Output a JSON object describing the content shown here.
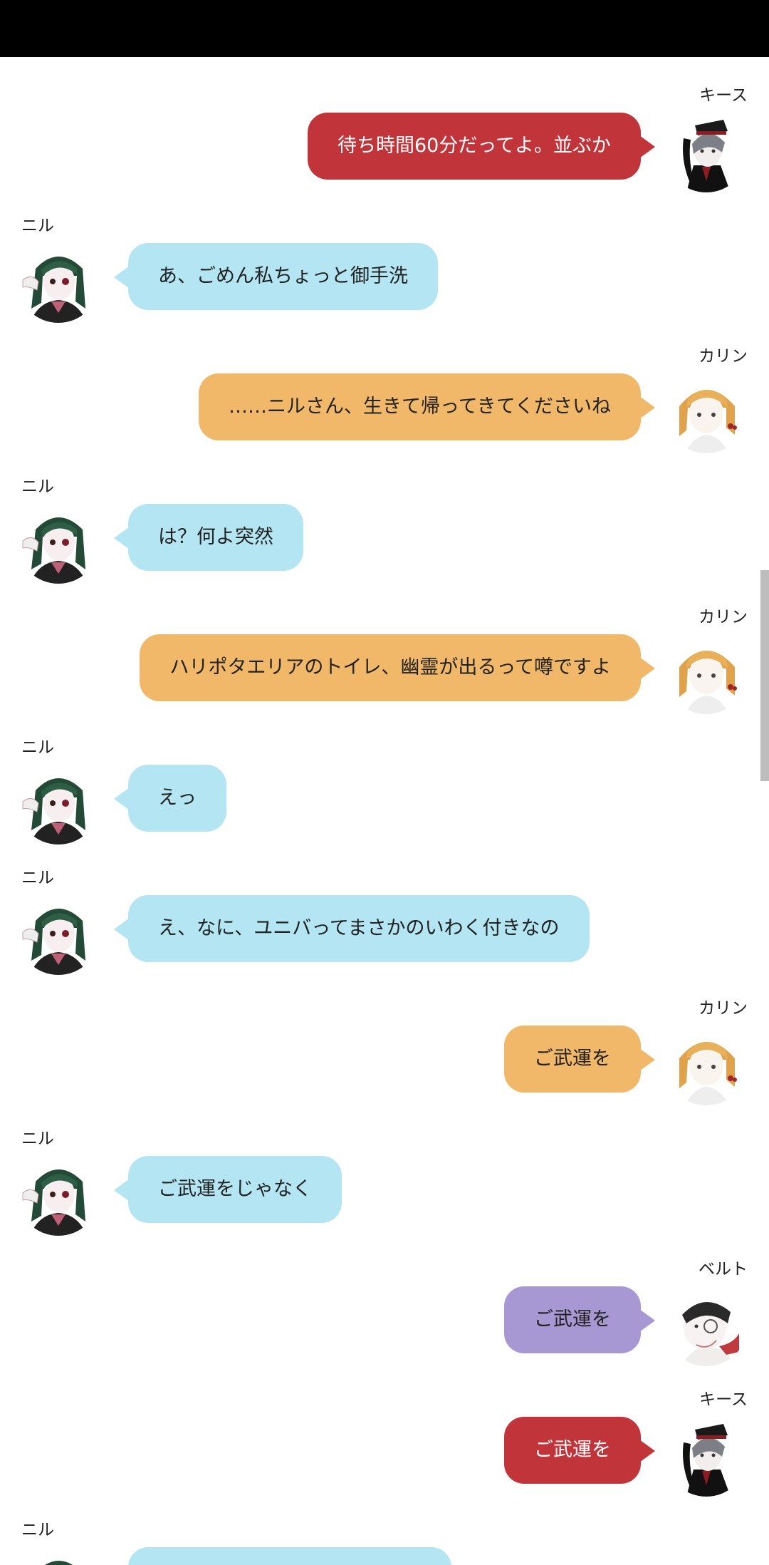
{
  "colors": {
    "niru": "#b3e5f2",
    "karin": "#f0b868",
    "keith": "#c0343a",
    "belt": "#a797d2"
  },
  "messages": [
    {
      "side": "right",
      "speaker": "キース",
      "text": "待ち時間60分だってよ。並ぶか",
      "color": "keith",
      "avatar": "keith"
    },
    {
      "side": "left",
      "speaker": "ニル",
      "text": "あ、ごめん私ちょっと御手洗",
      "color": "niru",
      "avatar": "niru"
    },
    {
      "side": "right",
      "speaker": "カリン",
      "text": "……ニルさん、生きて帰ってきてくださいね",
      "color": "karin",
      "avatar": "karin"
    },
    {
      "side": "left",
      "speaker": "ニル",
      "text": "は？何よ突然",
      "color": "niru",
      "avatar": "niru"
    },
    {
      "side": "right",
      "speaker": "カリン",
      "text": "ハリポタエリアのトイレ、幽霊が出るって噂ですよ",
      "color": "karin",
      "avatar": "karin"
    },
    {
      "side": "left",
      "speaker": "ニル",
      "text": "えっ",
      "color": "niru",
      "avatar": "niru"
    },
    {
      "side": "left",
      "speaker": "ニル",
      "text": "え、なに、ユニバってまさかのいわく付きなの",
      "color": "niru",
      "avatar": "niru"
    },
    {
      "side": "right",
      "speaker": "カリン",
      "text": "ご武運を",
      "color": "karin",
      "avatar": "karin"
    },
    {
      "side": "left",
      "speaker": "ニル",
      "text": "ご武運をじゃなく",
      "color": "niru",
      "avatar": "niru"
    },
    {
      "side": "right",
      "speaker": "ベルト",
      "text": "ご武運を",
      "color": "belt",
      "avatar": "belt"
    },
    {
      "side": "right",
      "speaker": "キース",
      "text": "ご武運を",
      "color": "keith",
      "avatar": "keith"
    },
    {
      "side": "left",
      "speaker": "ニル",
      "text": "",
      "color": "niru",
      "avatar": "niru"
    }
  ]
}
